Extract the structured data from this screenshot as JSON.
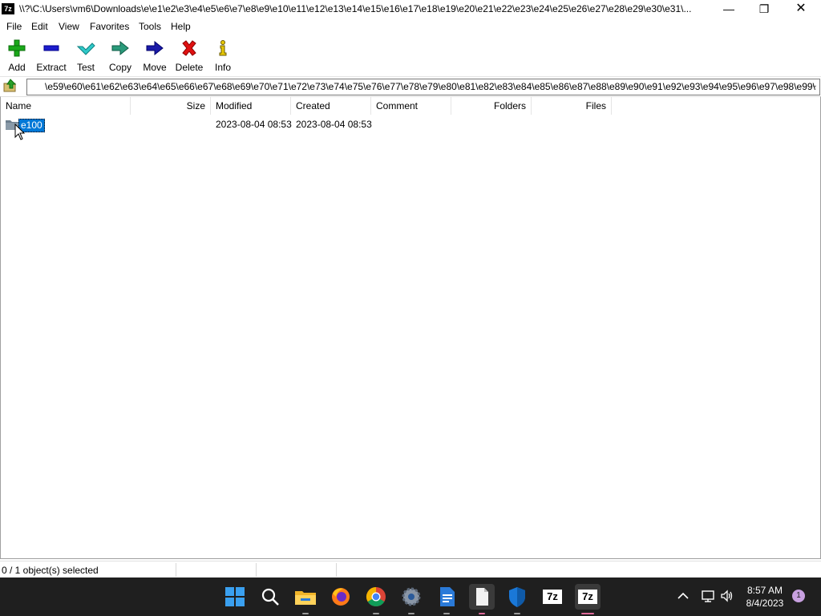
{
  "window": {
    "title": "\\\\?\\C:\\Users\\vm6\\Downloads\\e\\e1\\e2\\e3\\e4\\e5\\e6\\e7\\e8\\e9\\e10\\e11\\e12\\e13\\e14\\e15\\e16\\e17\\e18\\e19\\e20\\e21\\e22\\e23\\e24\\e25\\e26\\e27\\e28\\e29\\e30\\e31\\...",
    "app_icon_text": "7z"
  },
  "menu": [
    "File",
    "Edit",
    "View",
    "Favorites",
    "Tools",
    "Help"
  ],
  "toolbar": {
    "add": "Add",
    "extract": "Extract",
    "test": "Test",
    "copy": "Copy",
    "move": "Move",
    "delete": "Delete",
    "info": "Info"
  },
  "address": {
    "path": "\\e59\\e60\\e61\\e62\\e63\\e64\\e65\\e66\\e67\\e68\\e69\\e70\\e71\\e72\\e73\\e74\\e75\\e76\\e77\\e78\\e79\\e80\\e81\\e82\\e83\\e84\\e85\\e86\\e87\\e88\\e89\\e90\\e91\\e92\\e93\\e94\\e95\\e96\\e97\\e98\\e99\\"
  },
  "columns": {
    "name": "Name",
    "size": "Size",
    "modified": "Modified",
    "created": "Created",
    "comment": "Comment",
    "folders": "Folders",
    "files": "Files"
  },
  "rows": [
    {
      "name": "e100",
      "size": "",
      "modified": "2023-08-04 08:53",
      "created": "2023-08-04 08:53",
      "comment": "",
      "folders": "",
      "files": ""
    }
  ],
  "status": {
    "selection": "0 / 1 object(s) selected"
  },
  "taskbar": {
    "time": "8:57 AM",
    "date": "8/4/2023",
    "notification_count": "1",
    "app_7z_label": "7z",
    "app_7z2_label": "7z"
  },
  "colors": {
    "selection": "#0078d7",
    "taskbar": "#1f1f1f"
  }
}
